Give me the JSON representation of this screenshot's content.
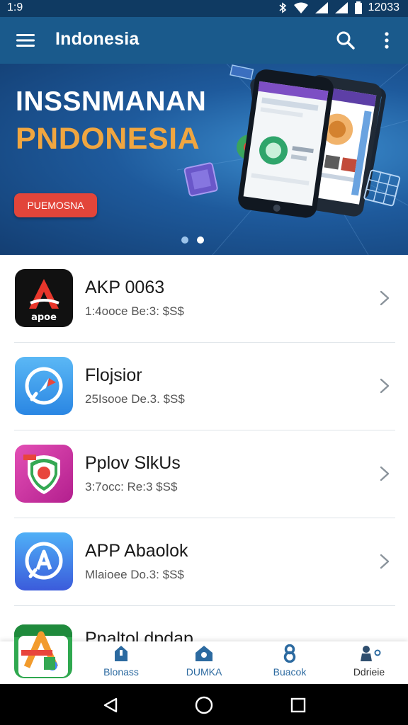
{
  "status_bar": {
    "time": "1:9",
    "clock_right": "12033"
  },
  "app_bar": {
    "title": "Indonesia",
    "menu_icon": "hamburger-menu-icon",
    "search_icon": "search-icon",
    "more_icon": "more-vert-icon",
    "color": "#1a5a8c"
  },
  "banner": {
    "line1": "INSSNMANAN",
    "line2": "PNDONESIA",
    "cta_label": "PUEMOSNA",
    "line2_color": "#f0a640",
    "cta_color": "#e2453a",
    "page_count": 2,
    "active_page": 2
  },
  "apps": [
    {
      "title": "AKP 0063",
      "subtitle": "1:4ooce Be:3: $S$",
      "icon": "apoe-logo-icon"
    },
    {
      "title": "Flojsior",
      "subtitle": "25Isooe De.3. $S$",
      "icon": "compass-app-icon"
    },
    {
      "title": "Pplov SlkUs",
      "subtitle": "3:7occ: Re:3  $S$",
      "icon": "location-pin-app-icon"
    },
    {
      "title": "APP Abaolok",
      "subtitle": "Mlaioee Do.3: $S$",
      "icon": "app-store-icon"
    }
  ],
  "partial_app": {
    "title": "Pnaltol dpdap",
    "icon": "multicolor-a-app-icon"
  },
  "bottom_nav": [
    {
      "label": "Blonass",
      "icon": "home-icon"
    },
    {
      "label": "DUMKA",
      "icon": "house-icon"
    },
    {
      "label": "Buacok",
      "icon": "number-eight-icon"
    },
    {
      "label": "Ddrieie",
      "icon": "person-icon"
    }
  ],
  "system_nav": {
    "back_icon": "back-triangle-icon",
    "home_icon": "home-circle-icon",
    "recents_icon": "recents-square-icon"
  }
}
